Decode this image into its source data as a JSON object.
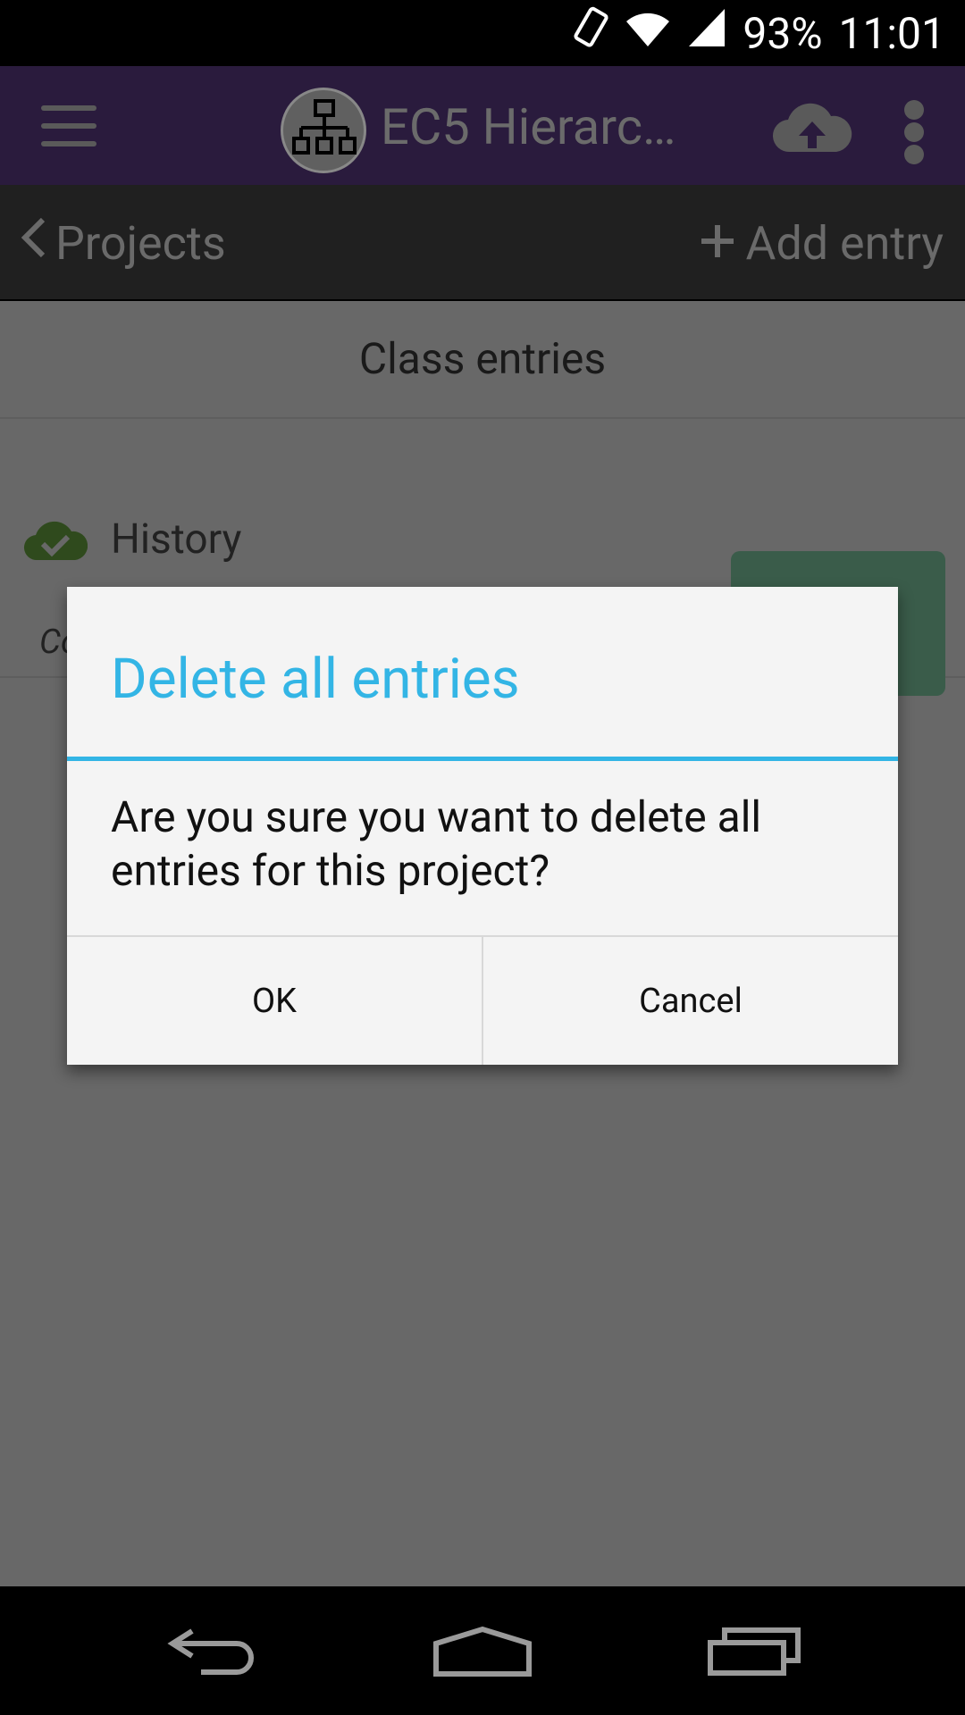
{
  "status_bar": {
    "battery": "93%",
    "time": "11:01"
  },
  "app_bar": {
    "title": "EC5 Hierarc…",
    "menu_icon": "menu-icon",
    "logo_icon": "hierarchy-icon",
    "upload_icon": "cloud-upload-icon",
    "more_icon": "more-vert-icon"
  },
  "nav": {
    "back_label": "Projects",
    "add_label": "Add entry"
  },
  "content": {
    "section_title": "Class entries",
    "entry": {
      "label": "History",
      "subtitle": "Co",
      "status_icon": "cloud-check-icon",
      "action_icon": "chevron-right-icon"
    }
  },
  "dialog": {
    "title": "Delete all entries",
    "message": "Are you sure you want to delete all entries for this project?",
    "ok_label": "OK",
    "cancel_label": "Cancel"
  },
  "colors": {
    "accent": "#33b5e5",
    "appbar": "#2a1b3d",
    "scrim_bg": "#686868",
    "go_button": "#3a5c4a"
  }
}
